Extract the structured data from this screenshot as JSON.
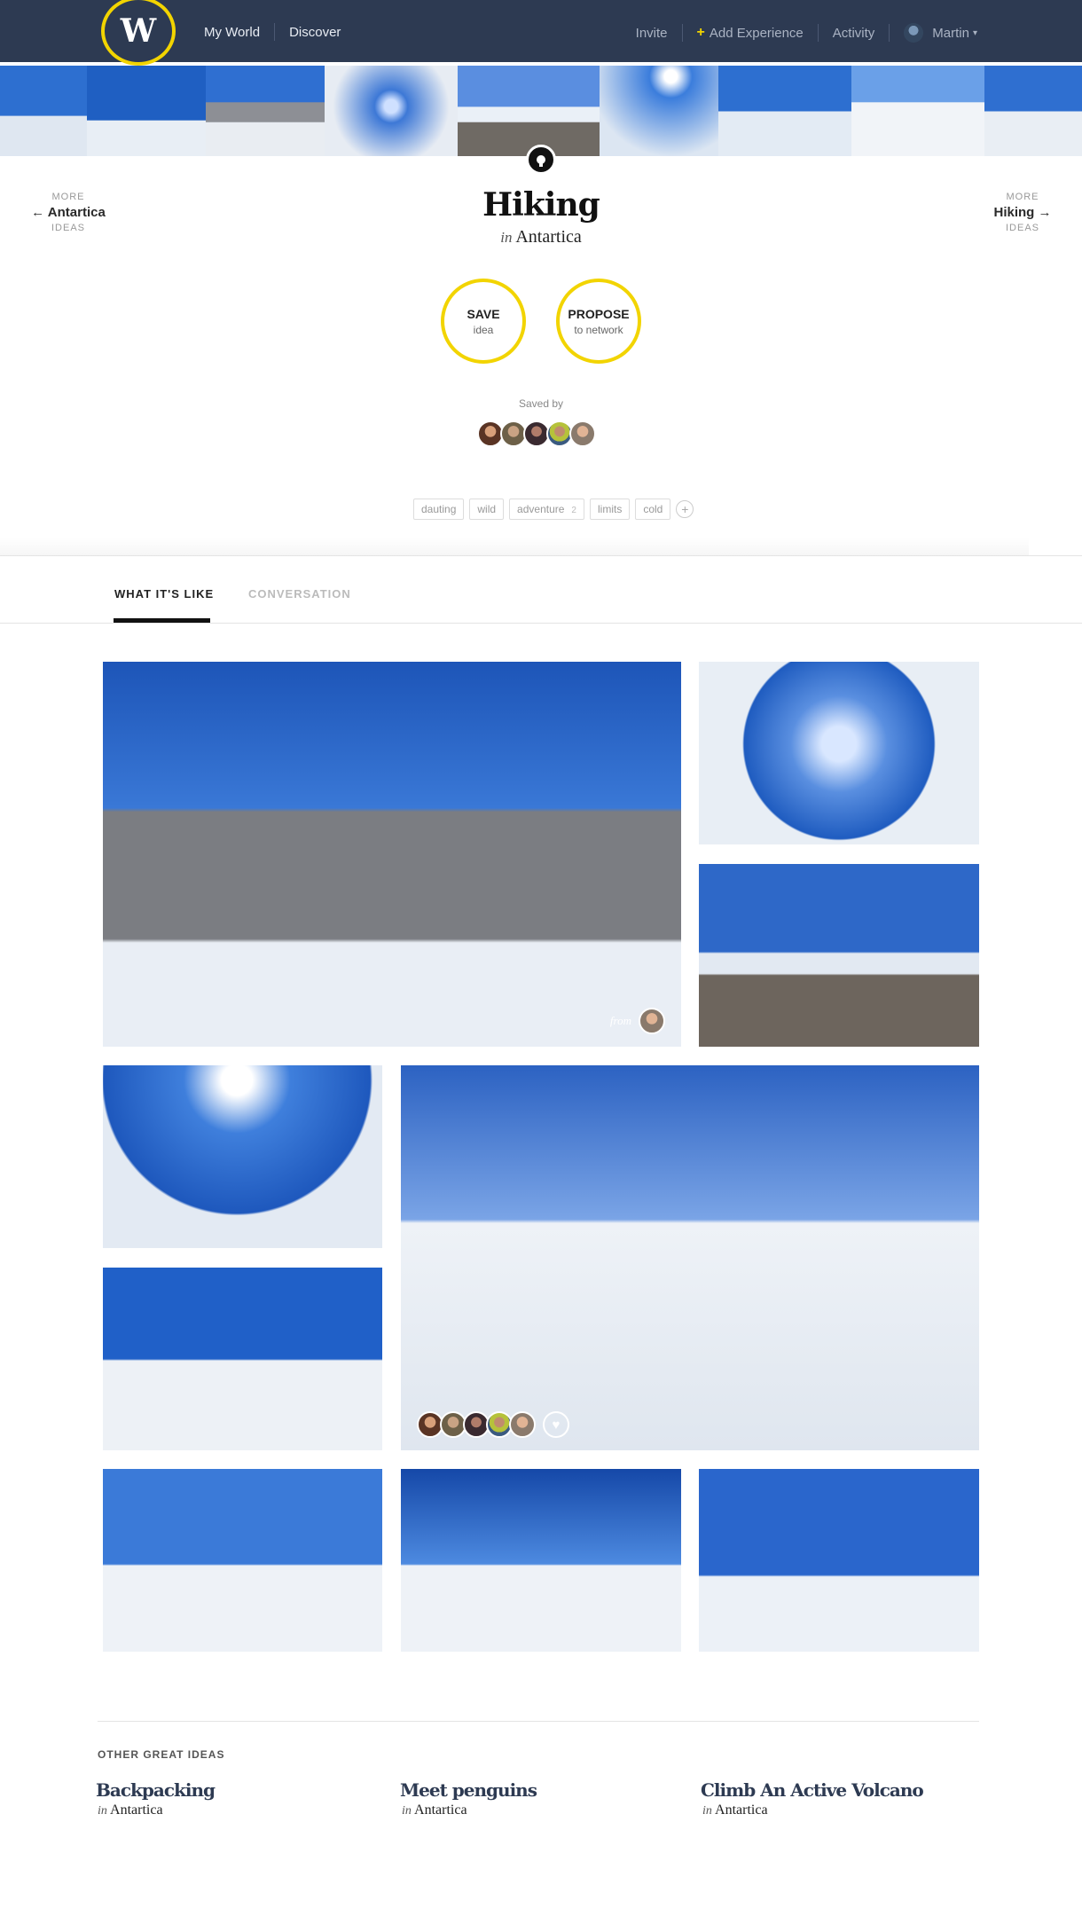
{
  "nav": {
    "logo_letter": "W",
    "left_items": [
      "My World",
      "Discover"
    ],
    "invite": "Invite",
    "add_experience": "Add Experience",
    "activity": "Activity",
    "user_name": "Martin"
  },
  "prev_link": {
    "top": "MORE",
    "label": "Antartica",
    "bottom": "IDEAS"
  },
  "next_link": {
    "top": "MORE",
    "label": "Hiking",
    "bottom": "IDEAS"
  },
  "idea": {
    "title": "Hiking",
    "in": "in",
    "location": "Antartica"
  },
  "actions": {
    "save": {
      "line1": "SAVE",
      "line2": "idea"
    },
    "propose": {
      "line1": "PROPOSE",
      "line2": "to network"
    }
  },
  "saved_by_label": "Saved by",
  "tags": [
    {
      "label": "dauting",
      "count": ""
    },
    {
      "label": "wild",
      "count": ""
    },
    {
      "label": "adventure",
      "count": "2"
    },
    {
      "label": "limits",
      "count": ""
    },
    {
      "label": "cold",
      "count": ""
    }
  ],
  "tag_add": "+",
  "tabs": [
    "WHAT IT'S LIKE",
    "CONVERSATION"
  ],
  "gallery": {
    "from_label": "from",
    "heart": "♥"
  },
  "other": {
    "heading": "OTHER GREAT IDEAS",
    "items": [
      {
        "title": "Backpacking",
        "in": "in",
        "location": "Antartica"
      },
      {
        "title": "Meet penguins",
        "in": "in",
        "location": "Antartica"
      },
      {
        "title": "Climb An Active Volcano",
        "in": "in",
        "location": "Antartica"
      }
    ]
  },
  "colors": {
    "nav_bg": "#2d3a52",
    "accent_yellow": "#f2d400",
    "title_blue": "#2d3a52"
  }
}
